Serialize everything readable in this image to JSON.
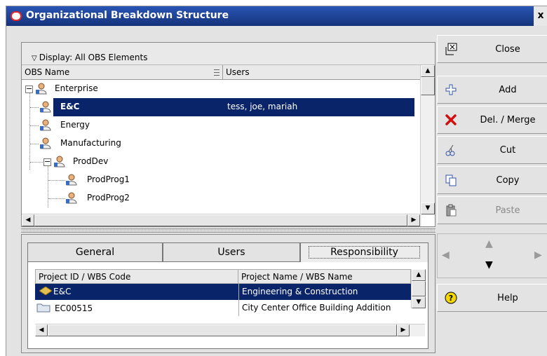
{
  "window": {
    "title": "Organizational Breakdown Structure",
    "close_glyph": "x"
  },
  "display": {
    "label": "Display: All OBS Elements"
  },
  "tree": {
    "columns": [
      "OBS Name",
      "Users"
    ],
    "rows": [
      {
        "name": "Enterprise",
        "users": ""
      },
      {
        "name": "E&C",
        "users": "tess, joe, mariah"
      },
      {
        "name": "Energy",
        "users": ""
      },
      {
        "name": "Manufacturing",
        "users": ""
      },
      {
        "name": "ProdDev",
        "users": ""
      },
      {
        "name": "ProdProg1",
        "users": ""
      },
      {
        "name": "ProdProg2",
        "users": ""
      }
    ]
  },
  "tabs": [
    "General",
    "Users",
    "Responsibility"
  ],
  "grid": {
    "columns": [
      "Project ID / WBS Code",
      "Project Name / WBS Name"
    ],
    "rows": [
      {
        "code": "E&C",
        "name": "Engineering & Construction"
      },
      {
        "code": "EC00515",
        "name": "City Center Office Building Addition"
      }
    ]
  },
  "buttons": {
    "close": "Close",
    "add": "Add",
    "del_merge": "Del. / Merge",
    "cut": "Cut",
    "copy": "Copy",
    "paste": "Paste",
    "help": "Help"
  },
  "colors": {
    "selection": "#0a246a",
    "titlebar": "#1d3f8f",
    "delete_icon": "#d01010"
  }
}
